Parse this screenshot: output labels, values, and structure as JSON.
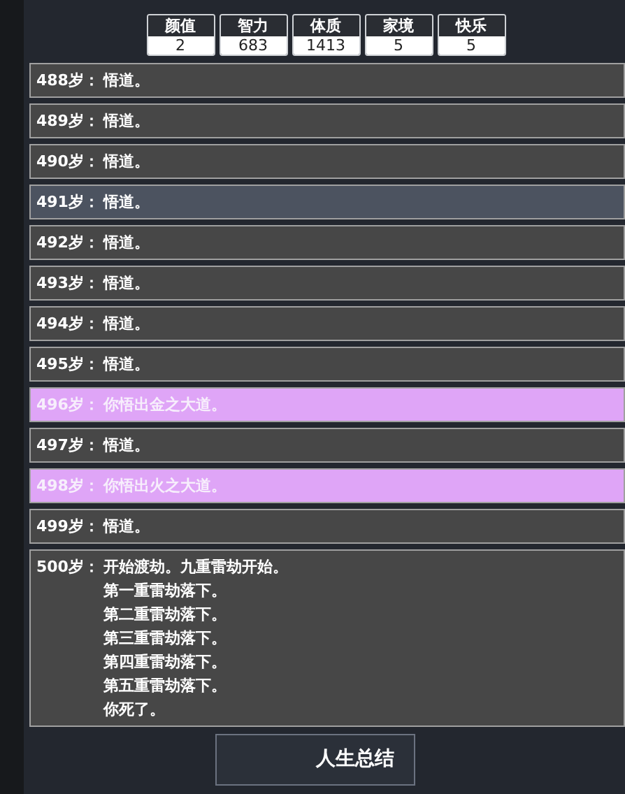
{
  "stats": [
    {
      "label": "颜值",
      "value": "2"
    },
    {
      "label": "智力",
      "value": "683"
    },
    {
      "label": "体质",
      "value": "1413"
    },
    {
      "label": "家境",
      "value": "5"
    },
    {
      "label": "快乐",
      "value": "5"
    }
  ],
  "log": [
    {
      "age": "488岁：",
      "lines": [
        "悟道。"
      ],
      "kind": "normal",
      "selected": false
    },
    {
      "age": "489岁：",
      "lines": [
        "悟道。"
      ],
      "kind": "normal",
      "selected": false
    },
    {
      "age": "490岁：",
      "lines": [
        "悟道。"
      ],
      "kind": "normal",
      "selected": false
    },
    {
      "age": "491岁：",
      "lines": [
        "悟道。"
      ],
      "kind": "normal",
      "selected": true
    },
    {
      "age": "492岁：",
      "lines": [
        "悟道。"
      ],
      "kind": "normal",
      "selected": false
    },
    {
      "age": "493岁：",
      "lines": [
        "悟道。"
      ],
      "kind": "normal",
      "selected": false
    },
    {
      "age": "494岁：",
      "lines": [
        "悟道。"
      ],
      "kind": "normal",
      "selected": false
    },
    {
      "age": "495岁：",
      "lines": [
        "悟道。"
      ],
      "kind": "normal",
      "selected": false
    },
    {
      "age": "496岁：",
      "lines": [
        "你悟出金之大道。"
      ],
      "kind": "special",
      "selected": false
    },
    {
      "age": "497岁：",
      "lines": [
        "悟道。"
      ],
      "kind": "normal",
      "selected": false
    },
    {
      "age": "498岁：",
      "lines": [
        "你悟出火之大道。"
      ],
      "kind": "special",
      "selected": false
    },
    {
      "age": "499岁：",
      "lines": [
        "悟道。"
      ],
      "kind": "normal",
      "selected": false
    },
    {
      "age": "500岁：",
      "lines": [
        "开始渡劫。九重雷劫开始。",
        "第一重雷劫落下。",
        "第二重雷劫落下。",
        "第三重雷劫落下。",
        "第四重雷劫落下。",
        "第五重雷劫落下。",
        "你死了。"
      ],
      "kind": "normal",
      "selected": false
    }
  ],
  "summary_button": "人生总结"
}
